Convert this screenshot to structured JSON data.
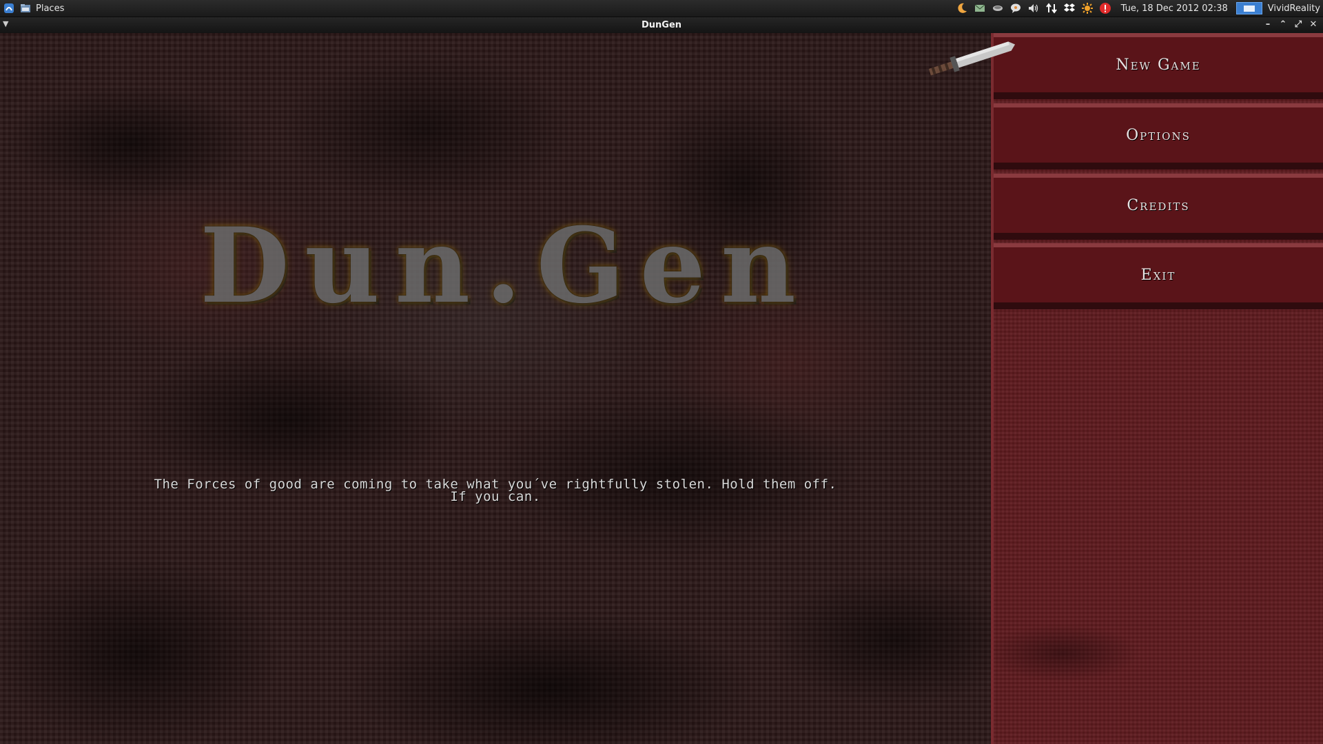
{
  "system_panel": {
    "places_label": "Places",
    "clock": "Tue, 18 Dec 2012 02:38",
    "user": "VividReality",
    "tray_icons": [
      "moon-icon",
      "mail-icon",
      "network-icon",
      "chat-icon",
      "volume-icon",
      "transfer-icon",
      "dropbox-icon",
      "update-icon",
      "alert-icon"
    ]
  },
  "window": {
    "title": "DunGen"
  },
  "game": {
    "logo": "Dun.Gen",
    "tagline_line1": "The Forces of good are coming to take what you´ve rightfully stolen. Hold them off.",
    "tagline_line2": "If you can."
  },
  "menu": {
    "new_game": "New Game",
    "options": "Options",
    "credits": "Credits",
    "exit": "Exit"
  },
  "colors": {
    "menu_panel": "#5e1a1e",
    "background": "#2a1717",
    "logo_glow": "#967014"
  }
}
